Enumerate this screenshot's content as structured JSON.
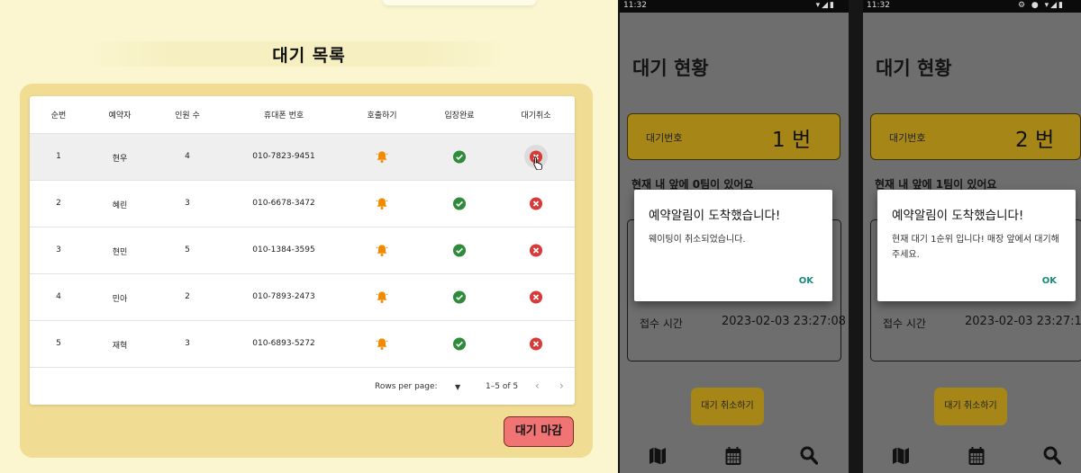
{
  "web": {
    "title": "대기 목록",
    "columns": [
      "순번",
      "예약자",
      "인원 수",
      "휴대폰 번호",
      "호출하기",
      "입장완료",
      "대기취소"
    ],
    "rows": [
      {
        "no": "1",
        "name": "현우",
        "count": "4",
        "phone": "010-7823-9451"
      },
      {
        "no": "2",
        "name": "혜린",
        "count": "3",
        "phone": "010-6678-3472"
      },
      {
        "no": "3",
        "name": "현민",
        "count": "5",
        "phone": "010-1384-3595"
      },
      {
        "no": "4",
        "name": "민아",
        "count": "2",
        "phone": "010-7893-2473"
      },
      {
        "no": "5",
        "name": "재혁",
        "count": "3",
        "phone": "010-6893-5272"
      }
    ],
    "pagination": {
      "rows_label": "Rows per page:",
      "range": "1–5 of 5"
    },
    "close_button": "대기 마감",
    "colors": {
      "bell": "#f28a00",
      "check": "#2e8b3a",
      "cancel": "#d83a3a",
      "close_btn": "#f07474",
      "panel": "#f1dc94"
    }
  },
  "phone1": {
    "time": "11:32",
    "status_icons": "▾◢▮",
    "title": "대기 현황",
    "wait_label": "대기번호",
    "wait_number": "1 번",
    "ahead_text": "현재 내 앞에 0팀이 있어요",
    "received_label": "접수 시간",
    "received_time": "2023-02-03 23:27:08",
    "cancel_button": "대기 취소하기",
    "dialog": {
      "title": "예약알림이 도착했습니다!",
      "message": "웨이팅이 취소되었습니다.",
      "ok": "OK"
    },
    "nav_icons": [
      "map-icon",
      "calendar-icon",
      "search-icon"
    ]
  },
  "phone2": {
    "time": "11:32",
    "status_icons": "⚙ ● ▾◢▮",
    "title": "대기 현황",
    "wait_label": "대기번호",
    "wait_number": "2 번",
    "ahead_text": "현재 내 앞에 1팀이 있어요",
    "received_label": "접수 시간",
    "received_time": "2023-02-03 23:27:11",
    "cancel_button": "대기 취소하기",
    "dialog": {
      "title": "예약알림이 도착했습니다!",
      "message": "현재 대기 1순위 입니다! 매장 앞에서 대기해 주세요.",
      "ok": "OK"
    },
    "nav_icons": [
      "map-icon",
      "calendar-icon",
      "search-icon"
    ]
  }
}
